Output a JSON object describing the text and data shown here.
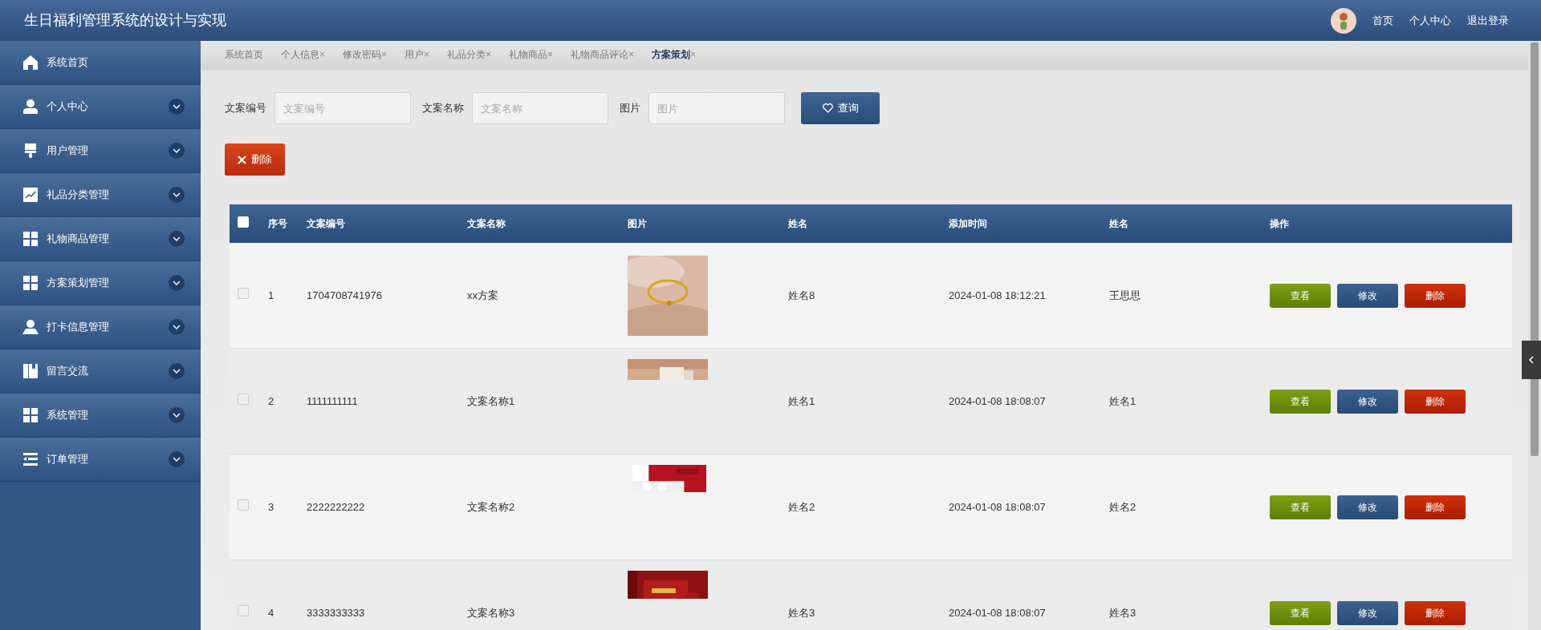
{
  "header": {
    "title": "生日福利管理系统的设计与实现",
    "links": [
      "首页",
      "个人中心",
      "退出登录"
    ]
  },
  "sidebar": {
    "items": [
      {
        "label": "系统首页",
        "has_submenu": false
      },
      {
        "label": "个人中心",
        "has_submenu": true
      },
      {
        "label": "用户管理",
        "has_submenu": true
      },
      {
        "label": "礼品分类管理",
        "has_submenu": true
      },
      {
        "label": "礼物商品管理",
        "has_submenu": true
      },
      {
        "label": "方案策划管理",
        "has_submenu": true
      },
      {
        "label": "打卡信息管理",
        "has_submenu": true
      },
      {
        "label": "留言交流",
        "has_submenu": true
      },
      {
        "label": "系统管理",
        "has_submenu": true
      },
      {
        "label": "订单管理",
        "has_submenu": true
      }
    ]
  },
  "tabs": [
    {
      "label": "系统首页",
      "selected": false
    },
    {
      "label": "个人信息",
      "close": "×",
      "selected": false
    },
    {
      "label": "修改密码",
      "close": "×",
      "selected": false
    },
    {
      "label": "用户",
      "close": "×",
      "selected": false
    },
    {
      "label": "礼品分类",
      "close": "×",
      "selected": false
    },
    {
      "label": "礼物商品",
      "close": "×",
      "selected": false
    },
    {
      "label": "礼物商品评论",
      "close": "×",
      "selected": false
    },
    {
      "label": "方案策划",
      "close": "×",
      "selected": true
    }
  ],
  "search": {
    "fields": [
      {
        "label": "文案编号",
        "placeholder": "文案编号"
      },
      {
        "label": "文案名称",
        "placeholder": "文案名称"
      },
      {
        "label": "图片",
        "placeholder": "图片"
      }
    ],
    "button": "查询"
  },
  "delete_button": "删除",
  "table": {
    "header_checked": false,
    "columns": [
      "序号",
      "文案编号",
      "文案名称",
      "图片",
      "姓名",
      "添加时间",
      "姓名",
      "操作"
    ],
    "rows": [
      {
        "checked": false,
        "index": "1",
        "code": "1704708741976",
        "name": "xx方案",
        "image": {
          "kind": "picture"
        },
        "person": "姓名8",
        "time": "2024-01-08 18:12:21",
        "name2": "王思思",
        "actions": [
          "查看",
          "修改",
          "删除"
        ]
      },
      {
        "checked": false,
        "index": "2",
        "code": "1111111111",
        "name": "文案名称1",
        "image": {
          "kind": "picture"
        },
        "person": "姓名1",
        "time": "2024-01-08 18:08:07",
        "name2": "姓名1",
        "actions": [
          "查看",
          "修改",
          "删除"
        ]
      },
      {
        "checked": false,
        "index": "3",
        "code": "2222222222",
        "name": "文案名称2",
        "image": {
          "kind": "picture"
        },
        "person": "姓名2",
        "time": "2024-01-08 18:08:07",
        "name2": "姓名2",
        "actions": [
          "查看",
          "修改",
          "删除"
        ]
      },
      {
        "checked": false,
        "index": "4",
        "code": "3333333333",
        "name": "文案名称3",
        "image": {
          "kind": "picture"
        },
        "person": "姓名3",
        "time": "2024-01-08 18:08:07",
        "name2": "姓名3",
        "actions": [
          "查看",
          "修改",
          "删除"
        ]
      }
    ]
  }
}
